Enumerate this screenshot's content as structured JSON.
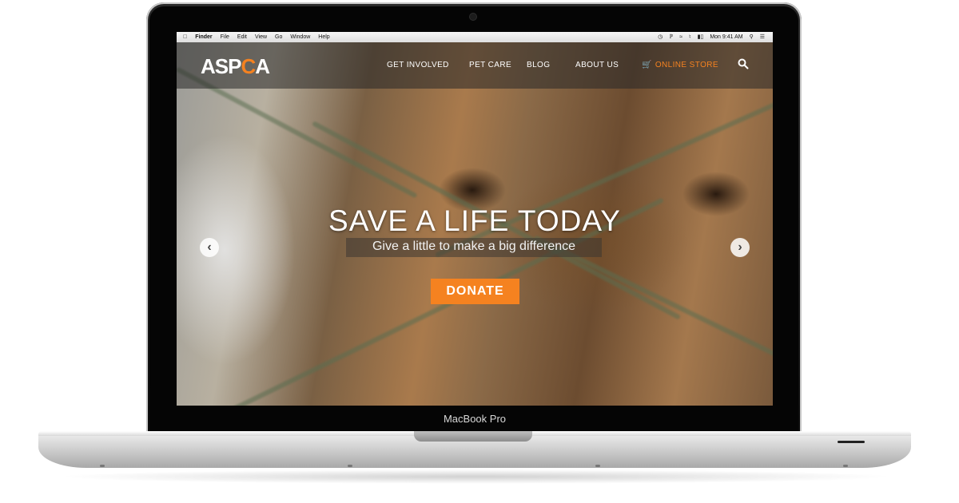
{
  "device": {
    "model_label": "MacBook Pro"
  },
  "menubar": {
    "apple": "",
    "items": [
      "Finder",
      "File",
      "Edit",
      "View",
      "Go",
      "Window",
      "Help"
    ],
    "clock": "Mon 9:41 AM"
  },
  "site": {
    "logo": {
      "prefix": "ASP",
      "accent": "C",
      "suffix": "A"
    },
    "nav": {
      "get_involved": "GET INVOLVED",
      "pet_care": "PET CARE",
      "blog": "BLOG",
      "about_us": "ABOUT US",
      "online_store": "ONLINE STORE"
    },
    "hero": {
      "headline": "SAVE A LIFE TODAY",
      "subtitle": "Give a little to make a big difference",
      "cta": "DONATE"
    },
    "carousel": {
      "prev": "‹",
      "next": "›"
    }
  },
  "colors": {
    "accent": "#f58220",
    "nav_overlay": "#282828",
    "text": "#ffffff"
  },
  "icons": [
    "apple-icon",
    "time-machine-icon",
    "bluetooth-icon",
    "wifi-icon",
    "volume-icon",
    "battery-icon",
    "spotlight-icon",
    "notification-center-icon",
    "cart-icon",
    "search-icon",
    "chevron-left-icon",
    "chevron-right-icon"
  ]
}
